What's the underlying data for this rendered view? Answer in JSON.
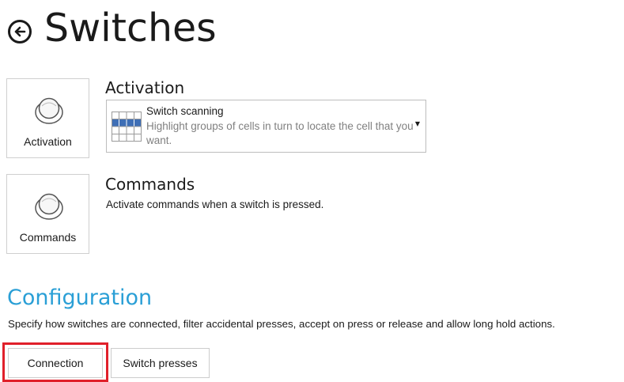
{
  "header": {
    "title": "Switches",
    "back_icon": "back-arrow-icon"
  },
  "activation": {
    "tile_label": "Activation",
    "heading": "Activation",
    "tile_icon": "switch-button-icon",
    "dropdown": {
      "selected_title": "Switch scanning",
      "selected_description": "Highlight groups of cells in turn to locate the cell that you want.",
      "icon": "scanning-grid-icon"
    }
  },
  "commands": {
    "tile_label": "Commands",
    "heading": "Commands",
    "description": "Activate commands when a switch is pressed.",
    "tile_icon": "switch-button-icon"
  },
  "configuration": {
    "heading": "Configuration",
    "description": "Specify how switches are connected, filter accidental presses, accept on press or release and allow long hold actions.",
    "buttons": {
      "connection": "Connection",
      "switch_presses": "Switch presses"
    }
  },
  "colors": {
    "accent": "#2a9fd6",
    "highlight": "#e0202a",
    "grid_blue": "#3f6fb6"
  }
}
